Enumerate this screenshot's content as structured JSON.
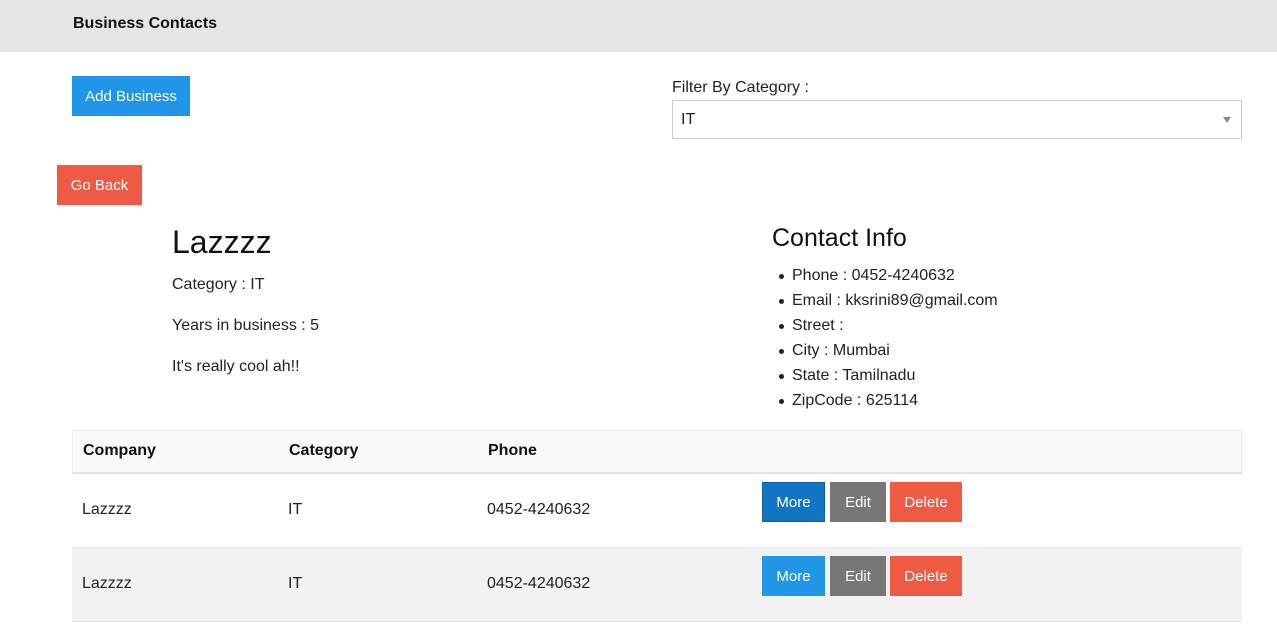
{
  "header": {
    "title": "Business Contacts"
  },
  "toolbar": {
    "add_label": "Add Business"
  },
  "filter": {
    "label": "Filter By Category :",
    "selected": "IT"
  },
  "back_label": "Go Back",
  "business": {
    "name": "Lazzzz",
    "category_line": "Category : IT",
    "years_line": "Years in business : 5",
    "description": "It's really cool ah!!"
  },
  "contact": {
    "title": "Contact Info",
    "items": [
      "Phone : 0452-4240632",
      "Email : kksrini89@gmail.com",
      "Street :",
      "City : Mumbai",
      "State : Tamilnadu",
      "ZipCode : 625114"
    ]
  },
  "table": {
    "columns": [
      "Company",
      "Category",
      "Phone"
    ],
    "rows": [
      {
        "company": "Lazzzz",
        "category": "IT",
        "phone": "0452-4240632"
      },
      {
        "company": "Lazzzz",
        "category": "IT",
        "phone": "0452-4240632"
      }
    ],
    "actions": {
      "more": "More",
      "edit": "Edit",
      "delete": "Delete"
    }
  },
  "colors": {
    "primary": "#2196e6",
    "primary_active": "#1275c4",
    "danger": "#ef5a44",
    "neutral": "#777777",
    "header_bg": "#e6e6e6"
  }
}
